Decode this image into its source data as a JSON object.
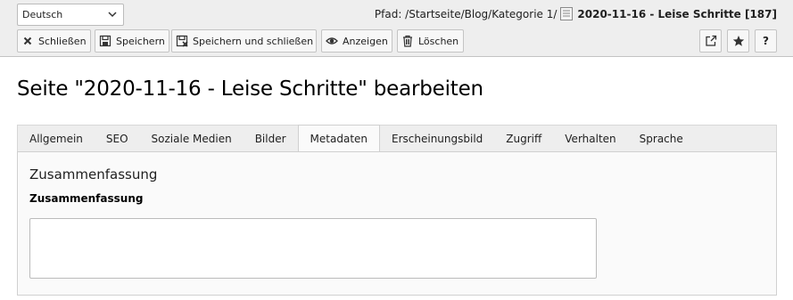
{
  "header": {
    "language_select": {
      "value": "Deutsch"
    },
    "path": {
      "label": "Pfad: /Startseite/Blog/Kategorie 1/",
      "record": "2020-11-16 - Leise Schritte [187]"
    },
    "buttons": {
      "close": "Schließen",
      "save": "Speichern",
      "save_close": "Speichern und schließen",
      "view": "Anzeigen",
      "delete": "Löschen"
    },
    "icons": {
      "close": "close-icon",
      "save": "floppy-disk-icon",
      "save_close": "floppy-disk-close-icon",
      "view": "eye-icon",
      "delete": "trash-icon",
      "open_new_window": "external-link-icon",
      "bookmark": "star-icon",
      "help": "help-icon"
    },
    "help_label": "?"
  },
  "main": {
    "title": "Seite \"2020-11-16 - Leise Schritte\" bearbeiten",
    "tabs": [
      {
        "label": "Allgemein",
        "active": false
      },
      {
        "label": "SEO",
        "active": false
      },
      {
        "label": "Soziale Medien",
        "active": false
      },
      {
        "label": "Bilder",
        "active": false
      },
      {
        "label": "Metadaten",
        "active": true
      },
      {
        "label": "Erscheinungsbild",
        "active": false
      },
      {
        "label": "Zugriff",
        "active": false
      },
      {
        "label": "Verhalten",
        "active": false
      },
      {
        "label": "Sprache",
        "active": false
      }
    ],
    "section": {
      "title": "Zusammenfassung",
      "field_label": "Zusammenfassung",
      "field_value": ""
    }
  }
}
